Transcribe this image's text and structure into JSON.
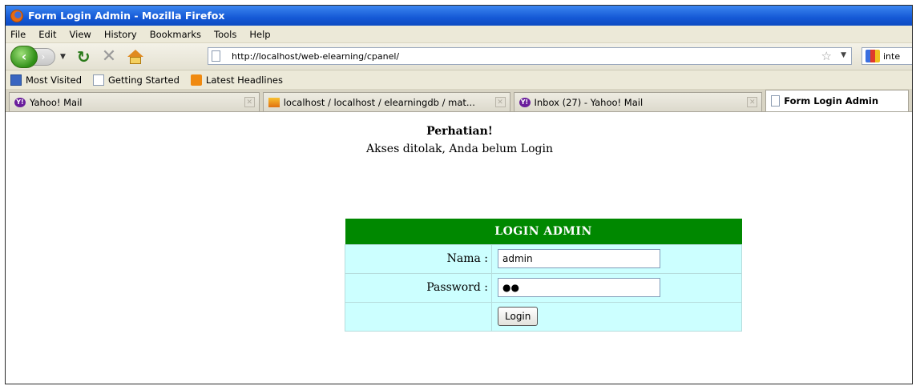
{
  "window": {
    "title": "Form Login Admin - Mozilla Firefox"
  },
  "menu": {
    "items": [
      "File",
      "Edit",
      "View",
      "History",
      "Bookmarks",
      "Tools",
      "Help"
    ]
  },
  "navigation": {
    "url": "http://localhost/web-elearning/cpanel/",
    "search_value": "inte"
  },
  "bookmarks": {
    "items": [
      "Most Visited",
      "Getting Started",
      "Latest Headlines"
    ]
  },
  "tabs": {
    "items": [
      {
        "label": "Yahoo! Mail",
        "icon": "yahoo-icon"
      },
      {
        "label": "localhost / localhost / elearningdb / mat...",
        "icon": "phpmyadmin-icon"
      },
      {
        "label": "Inbox (27) - Yahoo! Mail",
        "icon": "yahoo-icon"
      },
      {
        "label": "Form Login Admin",
        "icon": "page-icon"
      }
    ]
  },
  "page": {
    "notice_title": "Perhatian!",
    "notice_message": "Akses ditolak, Anda belum Login",
    "login_title": "LOGIN ADMIN",
    "username_label": "Nama",
    "username_value": "admin",
    "password_label": "Password",
    "password_value": "●●",
    "separator": ":",
    "login_button": "Login"
  },
  "colors": {
    "login_header": "#008800",
    "login_row": "#ccffff",
    "titlebar": "#1559d6"
  }
}
